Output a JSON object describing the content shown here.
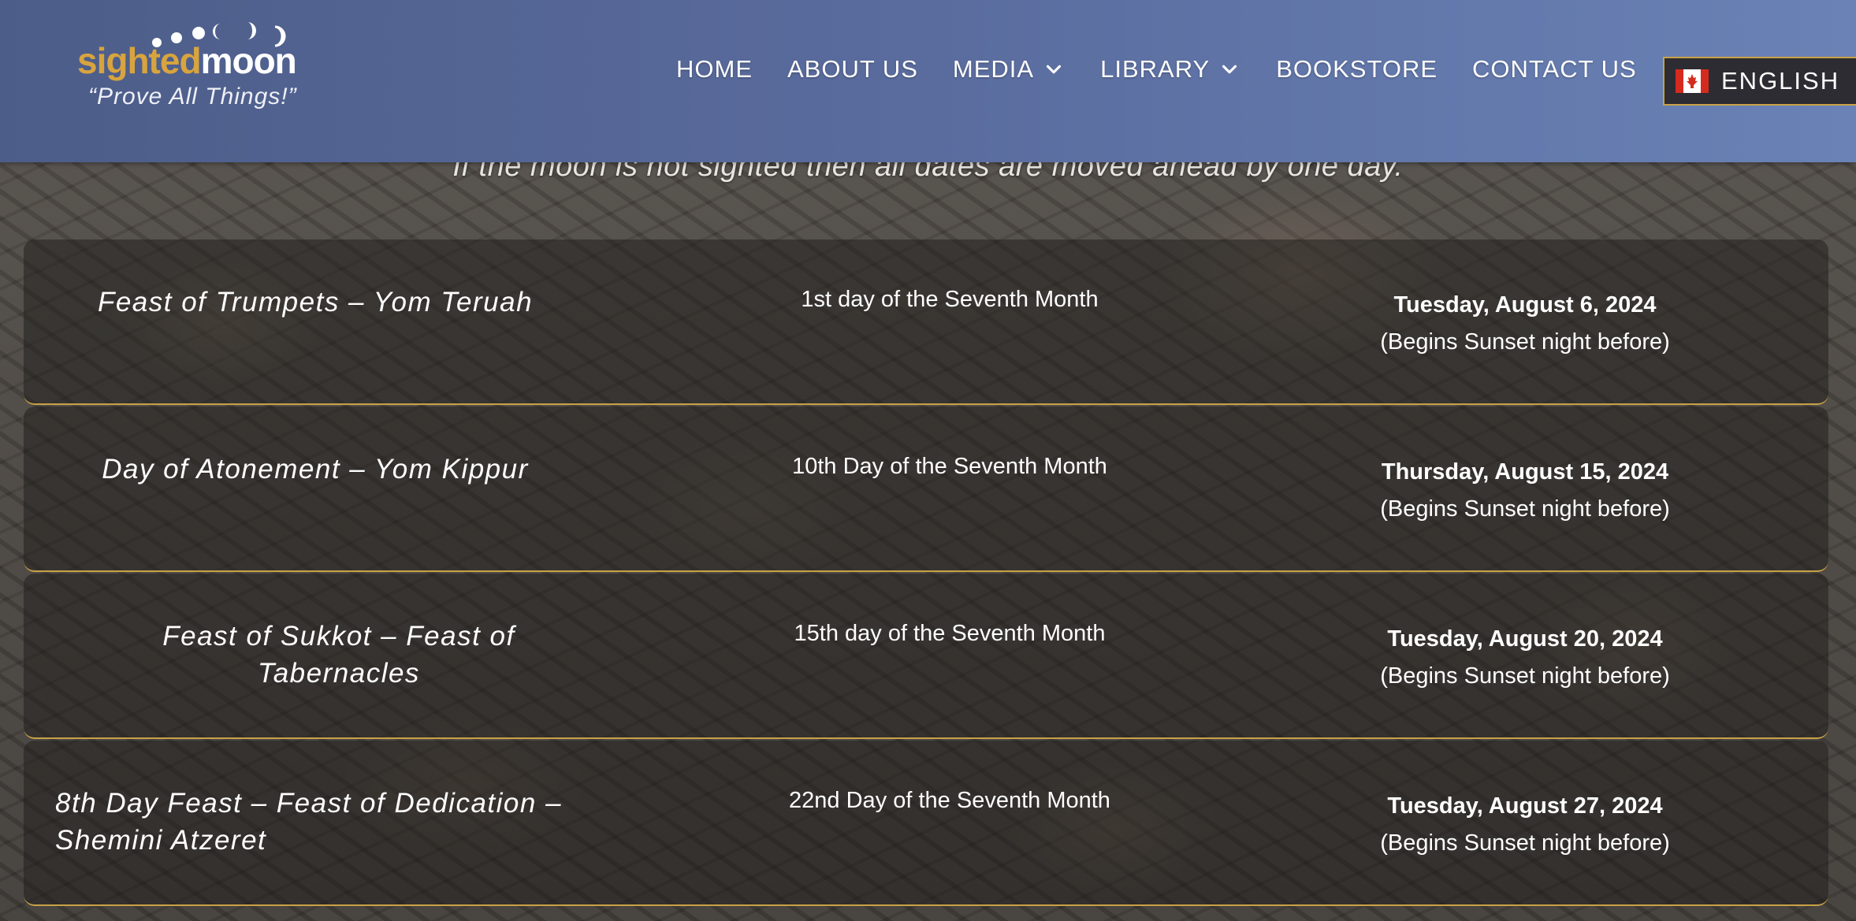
{
  "header": {
    "logo": {
      "word_part1": "sighted",
      "word_part2": "moon",
      "tagline": "“Prove All Things!”",
      "gold_color": "#d8a43e"
    },
    "nav": [
      {
        "label": "HOME",
        "has_dropdown": false
      },
      {
        "label": "ABOUT US",
        "has_dropdown": false
      },
      {
        "label": "MEDIA",
        "has_dropdown": true
      },
      {
        "label": "LIBRARY",
        "has_dropdown": true
      },
      {
        "label": "BOOKSTORE",
        "has_dropdown": false
      },
      {
        "label": "CONTACT US",
        "has_dropdown": false
      }
    ],
    "language": {
      "label": "ENGLISH",
      "icon": "canada-flag-icon"
    }
  },
  "notice": "If the moon is not sighted then all dates are moved ahead by one day.",
  "feasts": [
    {
      "name": "Feast of Trumpets – Yom Teruah",
      "day": "1st day of the Seventh Month",
      "date": "Tuesday, August 6, 2024",
      "note": "(Begins Sunset night before)"
    },
    {
      "name": "Day of Atonement – Yom Kippur",
      "day": "10th Day of the Seventh Month",
      "date": "Thursday, August 15, 2024",
      "note": "(Begins Sunset night before)"
    },
    {
      "name": "Feast of Sukkot – Feast of Tabernacles",
      "day": "15th day of the Seventh Month",
      "date": "Tuesday, August 20, 2024",
      "note": "(Begins Sunset night before)"
    },
    {
      "name": "8th Day Feast – Feast of Dedication – Shemini Atzeret",
      "day": "22nd Day of the Seventh Month",
      "date": "Tuesday, August 27, 2024",
      "note": "(Begins Sunset night before)"
    }
  ],
  "colors": {
    "accent_border": "#c9a246",
    "header_start": "#4d5d89",
    "header_end": "#6a82b6"
  }
}
